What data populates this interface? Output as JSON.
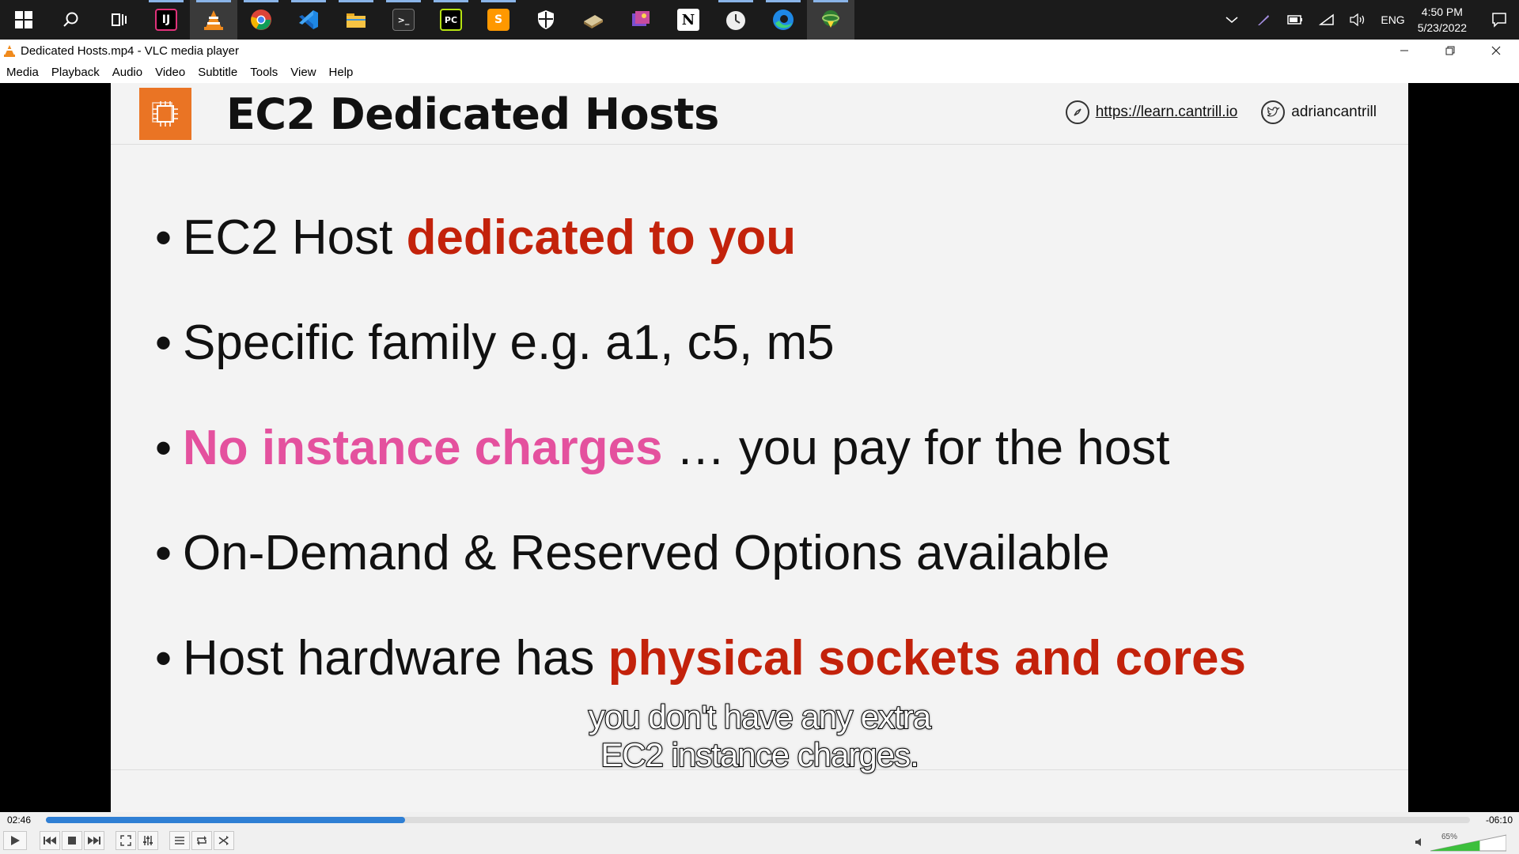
{
  "taskbar": {
    "apps": [
      {
        "name": "start",
        "label": ""
      },
      {
        "name": "search",
        "label": ""
      },
      {
        "name": "task-view",
        "label": ""
      },
      {
        "name": "intellij",
        "label": "IJ"
      },
      {
        "name": "vlc",
        "label": ""
      },
      {
        "name": "chrome",
        "label": ""
      },
      {
        "name": "vscode",
        "label": ""
      },
      {
        "name": "file-explorer",
        "label": ""
      },
      {
        "name": "terminal",
        "label": ">_"
      },
      {
        "name": "pycharm",
        "label": "PC"
      },
      {
        "name": "sublime",
        "label": "S"
      },
      {
        "name": "security",
        "label": ""
      },
      {
        "name": "app-book",
        "label": ""
      },
      {
        "name": "app-photos",
        "label": ""
      },
      {
        "name": "notion",
        "label": "N"
      },
      {
        "name": "clock-app",
        "label": ""
      },
      {
        "name": "edge",
        "label": ""
      },
      {
        "name": "idm",
        "label": ""
      }
    ],
    "tray": {
      "language": "ENG",
      "time": "4:50 PM",
      "date": "5/23/2022"
    }
  },
  "window": {
    "title": "Dedicated Hosts.mp4 - VLC media player",
    "menu": [
      "Media",
      "Playback",
      "Audio",
      "Video",
      "Subtitle",
      "Tools",
      "View",
      "Help"
    ]
  },
  "slide": {
    "title": "EC2 Dedicated Hosts",
    "link": "https://learn.cantrill.io",
    "twitter": "adriancantrill",
    "bullets": [
      {
        "plain": "EC2 Host ",
        "hl": "dedicated to you",
        "hl_style": "red",
        "rest": ""
      },
      {
        "plain": "Specific family e.g. a1, c5, m5",
        "hl": "",
        "hl_style": "",
        "rest": ""
      },
      {
        "plain": "",
        "hl": "No instance charges",
        "hl_style": "pink",
        "rest": " … you pay for the host"
      },
      {
        "plain": "On-Demand & Reserved Options available",
        "hl": "",
        "hl_style": "",
        "rest": ""
      },
      {
        "plain": "Host hardware has ",
        "hl": "physical sockets and cores",
        "hl_style": "red",
        "rest": ""
      }
    ]
  },
  "subtitle": {
    "line1": "you don't have any extra",
    "line2": "EC2 instance charges."
  },
  "player": {
    "elapsed": "02:46",
    "remaining": "-06:10",
    "progress_fraction": 0.252,
    "volume": "65%",
    "volume_fraction": 0.65
  },
  "colors": {
    "highlight_red": "#c3220b",
    "highlight_pink": "#e4519e",
    "ec2_orange": "#ea7424",
    "seek_blue": "#2f7fd4"
  }
}
